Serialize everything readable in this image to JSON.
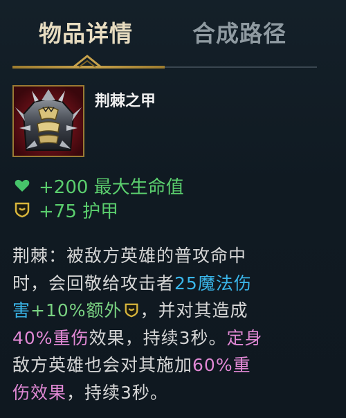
{
  "tabs": [
    {
      "label": "物品详情",
      "active": true
    },
    {
      "label": "合成路径",
      "active": false
    }
  ],
  "item": {
    "name": "荆棘之甲",
    "icon": "thornmail-item-icon"
  },
  "stats": [
    {
      "icon": "heart-icon",
      "text": "+200 最大生命值",
      "color": "#5bcf6e"
    },
    {
      "icon": "armor-shield-icon",
      "text": "+75 护甲",
      "color": "#5bcf6e"
    }
  ],
  "description": {
    "l1": {
      "t1": "荆棘：被敌方英雄的普攻命中"
    },
    "l2": {
      "t1": "时，会回敬给攻击者",
      "t2": "25魔法伤"
    },
    "l3": {
      "t1": "害",
      "t2": "+10%额外",
      "t3": "，并对其造成"
    },
    "l4": {
      "t1": "40%重伤",
      "t2": "效果，持续3秒。",
      "t3": "定身"
    },
    "l5": {
      "t1": "敌方英雄也会对其施加",
      "t2": "60%重"
    },
    "l6": {
      "t1": "伤效果",
      "t2": "，持续3秒。"
    }
  },
  "colors": {
    "accent_gold": "#c7a24c",
    "magic_damage_blue": "#3ab6ea",
    "stat_green": "#5bcf6e",
    "grievous_wounds_pink": "#e088d4"
  }
}
